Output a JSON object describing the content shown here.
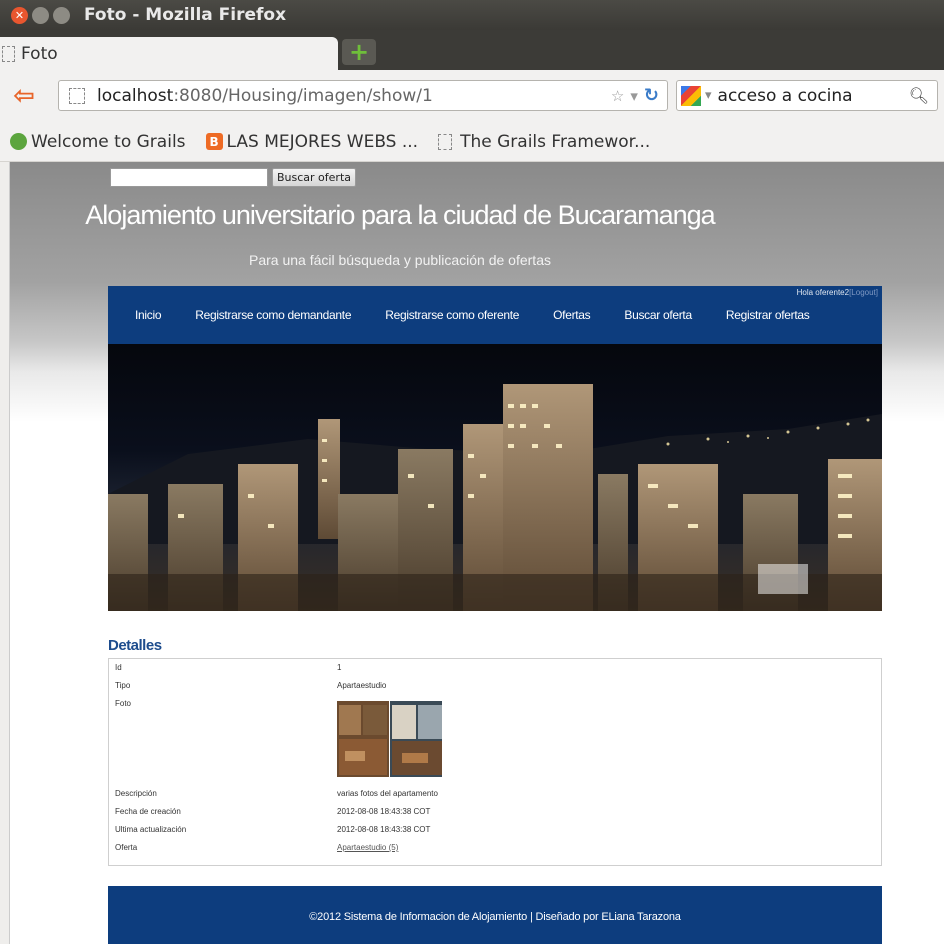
{
  "window": {
    "title": "Foto - Mozilla Firefox"
  },
  "tab": {
    "title": "Foto"
  },
  "urlbar": {
    "host": "localhost",
    "path": ":8080/Housing/imagen/show/1"
  },
  "search": {
    "value": "acceso a cocina"
  },
  "bookmarks": [
    {
      "label": "Welcome to Grails"
    },
    {
      "label": "LAS MEJORES WEBS ..."
    },
    {
      "label": "The Grails Framewor..."
    }
  ],
  "page": {
    "search_button": "Buscar oferta",
    "title": "Alojamiento universitario para la ciudad de Bucaramanga",
    "subtitle": "Para una fácil búsqueda y publicación de ofertas",
    "hello": "Hola oferente2",
    "logout": "[Logout]",
    "menu": [
      "Inicio",
      "Registrarse como demandante",
      "Registrarse como oferente",
      "Ofertas",
      "Buscar oferta",
      "Registrar ofertas"
    ],
    "details_heading": "Detalles",
    "details": [
      {
        "label": "Id",
        "value": "1"
      },
      {
        "label": "Tipo",
        "value": "Apartaestudio"
      },
      {
        "label": "Foto",
        "value": ""
      },
      {
        "label": "Descripción",
        "value": "varias fotos del apartamento"
      },
      {
        "label": "Fecha de creación",
        "value": "2012-08-08 18:43:38 COT"
      },
      {
        "label": "Ultima actualización",
        "value": "2012-08-08 18:43:38 COT"
      },
      {
        "label": "Oferta",
        "value": "Apartaestudio (5)"
      }
    ],
    "footer": "©2012 Sistema de Informacion de Alojamiento | Diseñado por ELiana Tarazona"
  },
  "colors": {
    "nav_blue": "#0d3d7e",
    "heading_blue": "#1d4c8d"
  }
}
